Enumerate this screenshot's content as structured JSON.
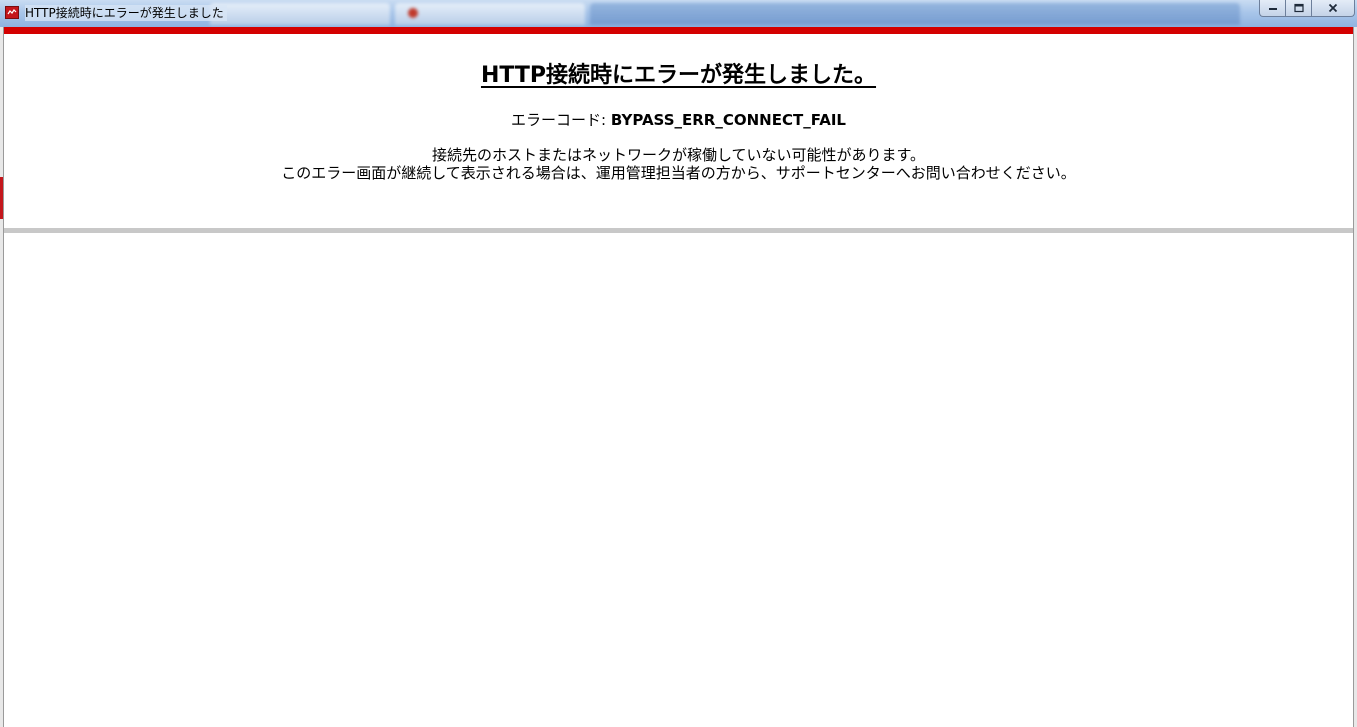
{
  "window": {
    "title": "HTTP接続時にエラーが発生しました"
  },
  "page": {
    "heading": "HTTP接続時にエラーが発生しました。",
    "error_code_label": "エラーコード: ",
    "error_code": "BYPASS_ERR_CONNECT_FAIL",
    "message_line1": "接続先のホストまたはネットワークが稼働していない可能性があります。",
    "message_line2": "このエラー画面が継続して表示される場合は、運用管理担当者の方から、サポートセンターへお問い合わせください。"
  },
  "colors": {
    "accent_red": "#d40000",
    "divider_grey": "#c8c8c8"
  },
  "icons": {
    "app": "app-icon",
    "minimize": "minimize-icon",
    "maximize": "maximize-icon",
    "close": "close-icon"
  }
}
